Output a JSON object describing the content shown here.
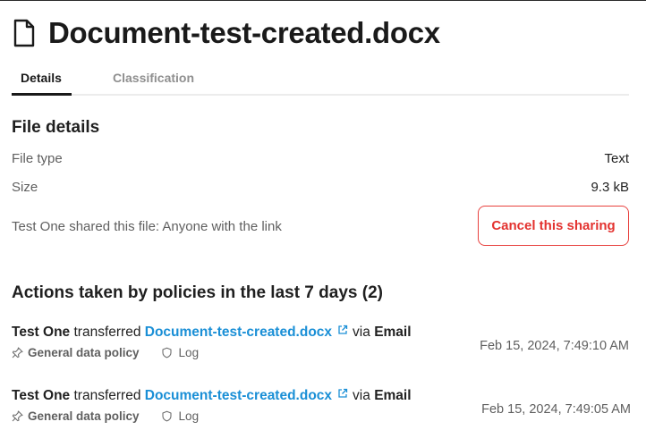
{
  "header": {
    "icon": "document-icon",
    "title": "Document-test-created.docx"
  },
  "tabs": [
    {
      "label": "Details",
      "active": true
    },
    {
      "label": "Classification",
      "active": false
    }
  ],
  "file_details": {
    "heading": "File details",
    "rows": [
      {
        "label": "File type",
        "value": "Text"
      },
      {
        "label": "Size",
        "value": "9.3 kB"
      }
    ],
    "sharing": {
      "text": "Test One shared this file: Anyone with the link",
      "cancel_label": "Cancel this sharing"
    }
  },
  "actions": {
    "heading": "Actions taken by policies in the last 7 days (2)",
    "items": [
      {
        "user": "Test One",
        "verb": "transferred",
        "document": "Document-test-created.docx",
        "via_text": "via",
        "channel": "Email",
        "policy": "General data policy",
        "outcome": "Log",
        "timestamp": "Feb 15, 2024, 7:49:10 AM"
      },
      {
        "user": "Test One",
        "verb": "transferred",
        "document": "Document-test-created.docx",
        "via_text": "via",
        "channel": "Email",
        "policy": "General data policy",
        "outcome": "Log",
        "timestamp": "Feb 15, 2024, 7:49:05 AM"
      }
    ]
  },
  "colors": {
    "link": "#1a8fd6",
    "danger": "#e3322f",
    "muted": "#5f5f5f",
    "tab_inactive": "#8f8f8f"
  }
}
